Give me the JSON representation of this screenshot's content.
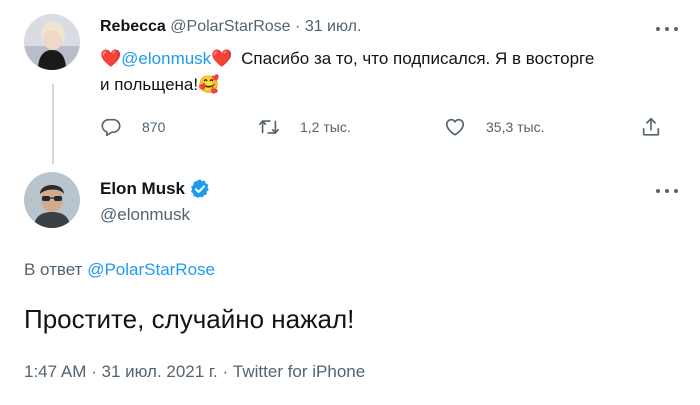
{
  "reply_tweet": {
    "author_name": "Rebecca",
    "handle": "@PolarStarRose",
    "separator": "·",
    "date": "31 июл.",
    "heart_left": "❤️",
    "mention": "@elonmusk",
    "heart_right": "❤️",
    "text_line1": "Спасибо за то, что подписался. Я в восторге",
    "text_line2": "и польщена!",
    "emoji": "🥰",
    "actions": {
      "reply_count": "870",
      "retweet_count": "1,2 тыс.",
      "like_count": "35,3 тыс."
    }
  },
  "main_tweet": {
    "author_name": "Elon Musk",
    "handle": "@elonmusk",
    "in_reply_to_prefix": "В ответ",
    "in_reply_to_handle": "@PolarStarRose",
    "text": "Простите, случайно нажал!",
    "time": "1:47 AM",
    "date": "31 июл. 2021 г.",
    "source": "Twitter for iPhone",
    "meta_separator": "·"
  },
  "colors": {
    "accent": "#1d9bf0",
    "text": "#0f1419",
    "muted": "#536471"
  },
  "icons": [
    "reply-icon",
    "retweet-icon",
    "like-icon",
    "share-icon",
    "verified-icon",
    "more-icon"
  ]
}
